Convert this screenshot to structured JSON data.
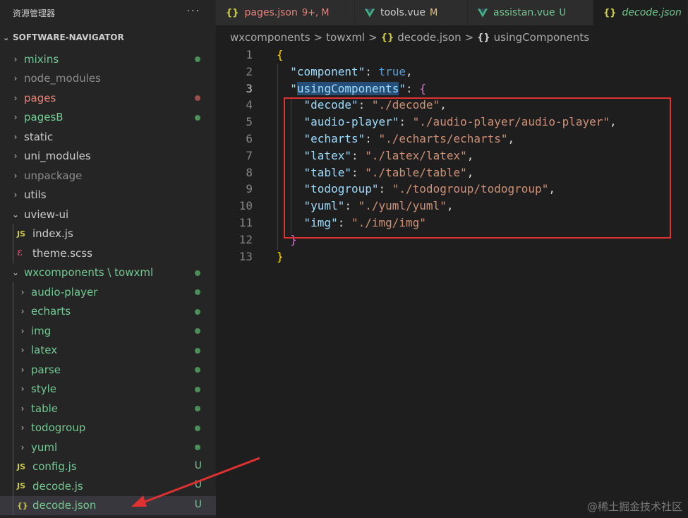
{
  "sidebar": {
    "title": "资源管理器",
    "more": "···",
    "project": "SOFTWARE-NAVIGATOR",
    "items": [
      {
        "label": "mixins",
        "chev": "›",
        "color": "green",
        "dot": "green",
        "depth": 0
      },
      {
        "label": "node_modules",
        "chev": "›",
        "color": "gray",
        "depth": 0
      },
      {
        "label": "pages",
        "chev": "›",
        "color": "red",
        "dot": "red",
        "depth": 0
      },
      {
        "label": "pagesB",
        "chev": "›",
        "color": "green",
        "dot": "green",
        "depth": 0
      },
      {
        "label": "static",
        "chev": "›",
        "color": "default",
        "depth": 0
      },
      {
        "label": "uni_modules",
        "chev": "›",
        "color": "default",
        "depth": 0
      },
      {
        "label": "unpackage",
        "chev": "›",
        "color": "gray",
        "depth": 0
      },
      {
        "label": "utils",
        "chev": "›",
        "color": "default",
        "depth": 0
      },
      {
        "label": "uview-ui",
        "chev": "⌄",
        "color": "default",
        "depth": 0
      },
      {
        "label": "index.js",
        "icon": "JS",
        "iconType": "js",
        "color": "default",
        "depth": 1
      },
      {
        "label": "theme.scss",
        "icon": "ℰ",
        "iconType": "scss",
        "color": "default",
        "depth": 1
      },
      {
        "label": "wxcomponents \\ towxml",
        "chev": "⌄",
        "color": "green",
        "dot": "green",
        "depth": 0
      },
      {
        "label": "audio-player",
        "chev": "›",
        "color": "green",
        "dot": "green",
        "depth": 1
      },
      {
        "label": "echarts",
        "chev": "›",
        "color": "green",
        "dot": "green",
        "depth": 1
      },
      {
        "label": "img",
        "chev": "›",
        "color": "green",
        "dot": "green",
        "depth": 1
      },
      {
        "label": "latex",
        "chev": "›",
        "color": "green",
        "dot": "green",
        "depth": 1
      },
      {
        "label": "parse",
        "chev": "›",
        "color": "green",
        "dot": "green",
        "depth": 1
      },
      {
        "label": "style",
        "chev": "›",
        "color": "green",
        "dot": "green",
        "depth": 1
      },
      {
        "label": "table",
        "chev": "›",
        "color": "green",
        "dot": "green",
        "depth": 1
      },
      {
        "label": "todogroup",
        "chev": "›",
        "color": "green",
        "dot": "green",
        "depth": 1
      },
      {
        "label": "yuml",
        "chev": "›",
        "color": "green",
        "dot": "green",
        "depth": 1
      },
      {
        "label": "config.js",
        "icon": "JS",
        "iconType": "js",
        "color": "green",
        "status": "U",
        "depth": 1
      },
      {
        "label": "decode.js",
        "icon": "JS",
        "iconType": "js",
        "color": "green",
        "status": "U",
        "depth": 1
      },
      {
        "label": "decode.json",
        "icon": "{}",
        "iconType": "json",
        "color": "green",
        "status": "U",
        "depth": 1,
        "selected": true
      }
    ]
  },
  "tabs": [
    {
      "icon": "{}",
      "iconType": "json",
      "label": "pages.json",
      "status": "9+, M",
      "color": "#e2827a"
    },
    {
      "icon": "vue",
      "iconType": "vue",
      "label": "tools.vue",
      "status": "M",
      "color": "#cccccc",
      "statusColor": "#e2c08d"
    },
    {
      "icon": "vue",
      "iconType": "vue",
      "label": "assistan.vue",
      "status": "U",
      "color": "#73c991",
      "statusColor": "#73c991"
    },
    {
      "icon": "{}",
      "iconType": "json",
      "label": "decode.json",
      "status": "",
      "color": "#73c991",
      "italic": true,
      "active": true
    }
  ],
  "breadcrumb": {
    "parts": [
      "wxcomponents",
      "towxml",
      "decode.json",
      "usingComponents"
    ],
    "json_icon": "{}",
    "sep": ">"
  },
  "editor": {
    "current_line": 3,
    "lines": [
      [
        {
          "t": "{",
          "c": "br1"
        }
      ],
      [
        {
          "t": "  "
        },
        {
          "t": "\"component\"",
          "c": "k"
        },
        {
          "t": ": "
        },
        {
          "t": "true",
          "c": "b"
        },
        {
          "t": ","
        }
      ],
      [
        {
          "t": "  "
        },
        {
          "t": "\"",
          "c": "k"
        },
        {
          "t": "usingComponents",
          "c": "k hl"
        },
        {
          "t": "\"",
          "c": "k"
        },
        {
          "t": ": "
        },
        {
          "t": "{",
          "c": "br2"
        }
      ],
      [
        {
          "t": "    "
        },
        {
          "t": "\"decode\"",
          "c": "k"
        },
        {
          "t": ": "
        },
        {
          "t": "\"./decode\"",
          "c": "s"
        },
        {
          "t": ","
        }
      ],
      [
        {
          "t": "    "
        },
        {
          "t": "\"audio-player\"",
          "c": "k"
        },
        {
          "t": ": "
        },
        {
          "t": "\"./audio-player/audio-player\"",
          "c": "s"
        },
        {
          "t": ","
        }
      ],
      [
        {
          "t": "    "
        },
        {
          "t": "\"echarts\"",
          "c": "k"
        },
        {
          "t": ": "
        },
        {
          "t": "\"./echarts/echarts\"",
          "c": "s"
        },
        {
          "t": ","
        }
      ],
      [
        {
          "t": "    "
        },
        {
          "t": "\"latex\"",
          "c": "k"
        },
        {
          "t": ": "
        },
        {
          "t": "\"./latex/latex\"",
          "c": "s"
        },
        {
          "t": ","
        }
      ],
      [
        {
          "t": "    "
        },
        {
          "t": "\"table\"",
          "c": "k"
        },
        {
          "t": ": "
        },
        {
          "t": "\"./table/table\"",
          "c": "s"
        },
        {
          "t": ","
        }
      ],
      [
        {
          "t": "    "
        },
        {
          "t": "\"todogroup\"",
          "c": "k"
        },
        {
          "t": ": "
        },
        {
          "t": "\"./todogroup/todogroup\"",
          "c": "s"
        },
        {
          "t": ","
        }
      ],
      [
        {
          "t": "    "
        },
        {
          "t": "\"yuml\"",
          "c": "k"
        },
        {
          "t": ": "
        },
        {
          "t": "\"./yuml/yuml\"",
          "c": "s"
        },
        {
          "t": ","
        }
      ],
      [
        {
          "t": "    "
        },
        {
          "t": "\"img\"",
          "c": "k"
        },
        {
          "t": ": "
        },
        {
          "t": "\"./img/img\"",
          "c": "s"
        }
      ],
      [
        {
          "t": "  "
        },
        {
          "t": "}",
          "c": "br2"
        }
      ],
      [
        {
          "t": "}",
          "c": "br1"
        }
      ]
    ]
  },
  "watermark": "@稀土掘金技术社区",
  "colors": {
    "annotation": "#e03131",
    "git_untracked": "#73c991",
    "git_modified": "#e2c08d",
    "git_error": "#e2827a"
  }
}
